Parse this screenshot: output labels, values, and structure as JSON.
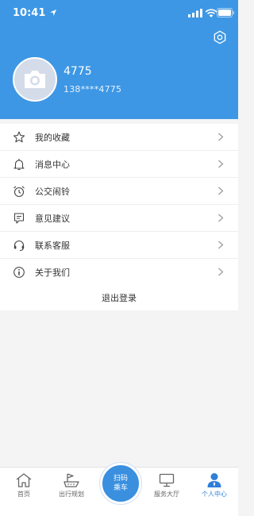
{
  "status_bar": {
    "time": "10:41"
  },
  "header": {
    "username": "4775",
    "phone": "138****4775"
  },
  "menu": {
    "items": [
      {
        "label": "我的收藏",
        "icon": "star-icon"
      },
      {
        "label": "消息中心",
        "icon": "bell-icon"
      },
      {
        "label": "公交闹铃",
        "icon": "alarm-clock-icon"
      },
      {
        "label": "意见建议",
        "icon": "feedback-icon"
      },
      {
        "label": "联系客服",
        "icon": "headset-icon"
      },
      {
        "label": "关于我们",
        "icon": "info-icon"
      }
    ]
  },
  "logout_label": "退出登录",
  "tabbar": {
    "home": "首页",
    "trip_plan": "出行规划",
    "scan_line1": "扫码",
    "scan_line2": "乘车",
    "service_hall": "服务大厅",
    "profile": "个人中心"
  },
  "colors": {
    "brand": "#3d97e4",
    "active_tab": "#2f7fd8"
  }
}
